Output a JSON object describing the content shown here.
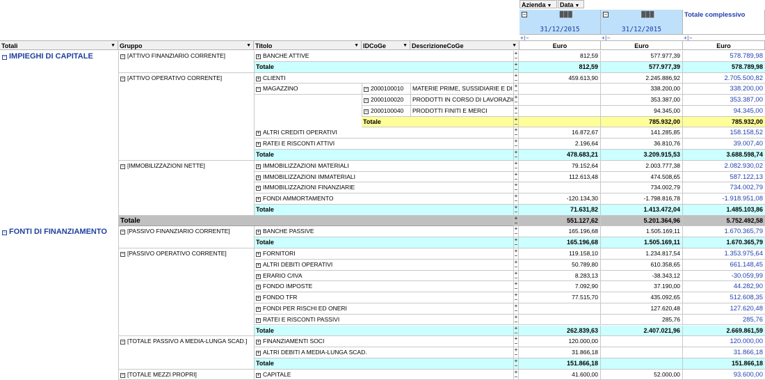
{
  "filters": {
    "azienda": "Azienda",
    "data": "Data"
  },
  "columns": {
    "totali": "Totali",
    "gruppo": "Gruppo",
    "titolo": "Titolo",
    "idcoge": "IDCoGe",
    "descrizione": "DescrizioneCoGe",
    "total_header": "Totale complessivo",
    "company_a": "███",
    "company_b": "███",
    "date_a": "31/12/2015",
    "date_b": "31/12/2015",
    "unit": "Euro",
    "collapse_symbol": "−",
    "expand_symbol": "+",
    "plusminus": "+|−"
  },
  "categories": [
    {
      "label": "IMPIEGHI DI CAPITALE",
      "start": 0
    },
    {
      "label": "FONTI DI FINANZIAMENTO",
      "start": 16
    }
  ],
  "groups": [
    {
      "label": "[ATTIVO FINANZIARIO CORRENTE]",
      "start": 0
    },
    {
      "label": "[ATTIVO OPERATIVO CORRENTE]",
      "start": 2
    },
    {
      "label": "[IMMOBILIZZAZIONI NETTE]",
      "start": 10
    },
    {
      "label": "[PASSIVO FINANZIARIO CORRENTE]",
      "start": 16
    },
    {
      "label": "[PASSIVO OPERATIVO CORRENTE]",
      "start": 18
    },
    {
      "label": "[TOTALE PASSIVO A MEDIA-LUNGA SCAD.]",
      "start": 26
    },
    {
      "label": "[TOTALE MEZZI PROPRI]",
      "start": 29
    }
  ],
  "rows": [
    {
      "titolo": "BANCHE ATTIVE",
      "a": "812,59",
      "b": "577.977,39",
      "t": "578.789,98"
    },
    {
      "titolo": "Totale",
      "a": "812,59",
      "b": "577.977,39",
      "t": "578.789,98",
      "kind": "total"
    },
    {
      "titolo": "CLIENTI",
      "a": "459.613,90",
      "b": "2.245.886,92",
      "t": "2.705.500,82"
    },
    {
      "titolo": "MAGAZZINO",
      "id": "2000100010",
      "desc": "MATERIE PRIME, SUSSIDIARIE E DI CONSUMO",
      "a": "",
      "b": "338.200,00",
      "t": "338.200,00",
      "open": true
    },
    {
      "titolo": "",
      "id": "2000100020",
      "desc": "PRODOTTI IN CORSO DI LAVORAZIONE",
      "a": "",
      "b": "353.387,00",
      "t": "353.387,00"
    },
    {
      "titolo": "",
      "id": "2000100040",
      "desc": "PRODOTTI FINITI E MERCI",
      "a": "",
      "b": "94.345,00",
      "t": "94.345,00"
    },
    {
      "titolo": "",
      "sub": "Totale",
      "a": "",
      "b": "785.932,00",
      "t": "785.932,00",
      "kind": "subtotal"
    },
    {
      "titolo": "ALTRI CREDITI OPERATIVI",
      "a": "16.872,67",
      "b": "141.285,85",
      "t": "158.158,52"
    },
    {
      "titolo": "RATEI E RISCONTI ATTIVI",
      "a": "2.196,64",
      "b": "36.810,76",
      "t": "39.007,40"
    },
    {
      "titolo": "Totale",
      "a": "478.683,21",
      "b": "3.209.915,53",
      "t": "3.688.598,74",
      "kind": "total"
    },
    {
      "titolo": "IMMOBILIZZAZIONI MATERIALI",
      "a": "79.152,64",
      "b": "2.003.777,38",
      "t": "2.082.930,02"
    },
    {
      "titolo": "IMMOBILIZZAZIONI IMMATERIALI",
      "a": "112.613,48",
      "b": "474.508,65",
      "t": "587.122,13"
    },
    {
      "titolo": "IMMOBILIZZAZIONI FINANZIARIE",
      "a": "",
      "b": "734.002,79",
      "t": "734.002,79"
    },
    {
      "titolo": "FONDI AMMORTAMENTO",
      "a": "-120.134,30",
      "b": "-1.798.816,78",
      "t": "-1.918.951,08"
    },
    {
      "titolo": "Totale",
      "a": "71.631,82",
      "b": "1.413.472,04",
      "t": "1.485.103,86",
      "kind": "total"
    },
    {
      "titolo": "",
      "grand": "Totale",
      "a": "551.127,62",
      "b": "5.201.364,96",
      "t": "5.752.492,58",
      "kind": "grand"
    },
    {
      "titolo": "BANCHE PASSIVE",
      "a": "165.196,68",
      "b": "1.505.169,11",
      "t": "1.670.365,79"
    },
    {
      "titolo": "Totale",
      "a": "165.196,68",
      "b": "1.505.169,11",
      "t": "1.670.365,79",
      "kind": "total"
    },
    {
      "titolo": "FORNITORI",
      "a": "119.158,10",
      "b": "1.234.817,54",
      "t": "1.353.975,64"
    },
    {
      "titolo": "ALTRI DEBITI OPERATIVI",
      "a": "50.789,80",
      "b": "610.358,65",
      "t": "661.148,45"
    },
    {
      "titolo": "ERARIO C/IVA",
      "a": "8.283,13",
      "b": "-38.343,12",
      "t": "-30.059,99"
    },
    {
      "titolo": "FONDO IMPOSTE",
      "a": "7.092,90",
      "b": "37.190,00",
      "t": "44.282,90"
    },
    {
      "titolo": "FONDO TFR",
      "a": "77.515,70",
      "b": "435.092,65",
      "t": "512.608,35"
    },
    {
      "titolo": "FONDI PER RISCHI ED ONERI",
      "a": "",
      "b": "127.620,48",
      "t": "127.620,48"
    },
    {
      "titolo": "RATEI E RISCONTI PASSIVI",
      "a": "",
      "b": "285,76",
      "t": "285,76"
    },
    {
      "titolo": "Totale",
      "a": "262.839,63",
      "b": "2.407.021,96",
      "t": "2.669.861,59",
      "kind": "total"
    },
    {
      "titolo": "FINANZIAMENTI SOCI",
      "a": "120.000,00",
      "b": "",
      "t": "120.000,00"
    },
    {
      "titolo": "ALTRI DEBITI A MEDIA-LUNGA SCAD.",
      "a": "31.866,18",
      "b": "",
      "t": "31.866,18"
    },
    {
      "titolo": "Totale",
      "a": "151.866,18",
      "b": "",
      "t": "151.866,18",
      "kind": "total"
    },
    {
      "titolo": "CAPITALE",
      "a": "41.600,00",
      "b": "52.000,00",
      "t": "93.600,00"
    }
  ]
}
